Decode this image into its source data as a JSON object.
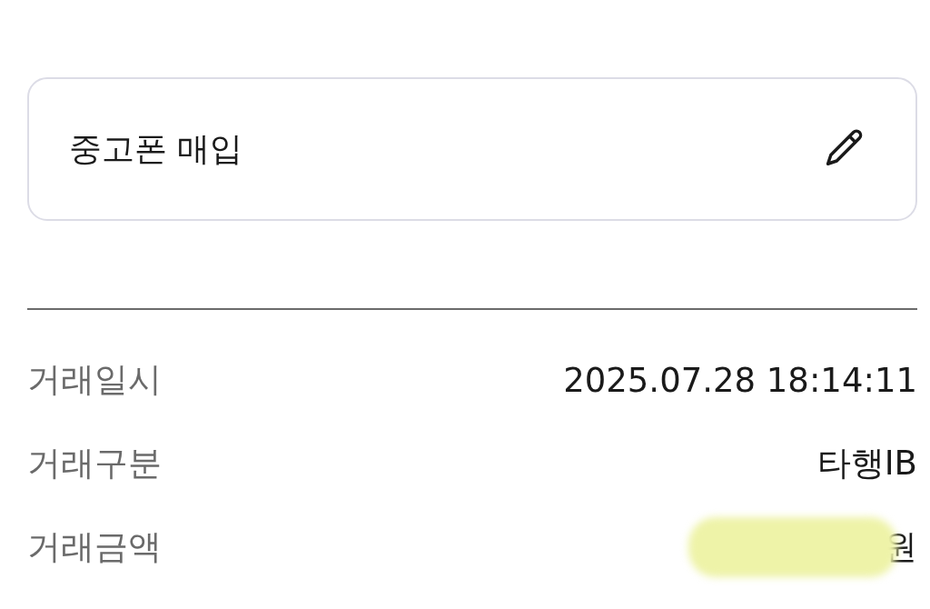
{
  "memo_card": {
    "text": "중고폰 매입"
  },
  "details": [
    {
      "label": "거래일시",
      "value": "2025.07.28 18:14:11",
      "redacted": false
    },
    {
      "label": "거래구분",
      "value": "타행IB",
      "redacted": false
    },
    {
      "label": "거래금액",
      "value": "원",
      "redacted": true
    }
  ]
}
